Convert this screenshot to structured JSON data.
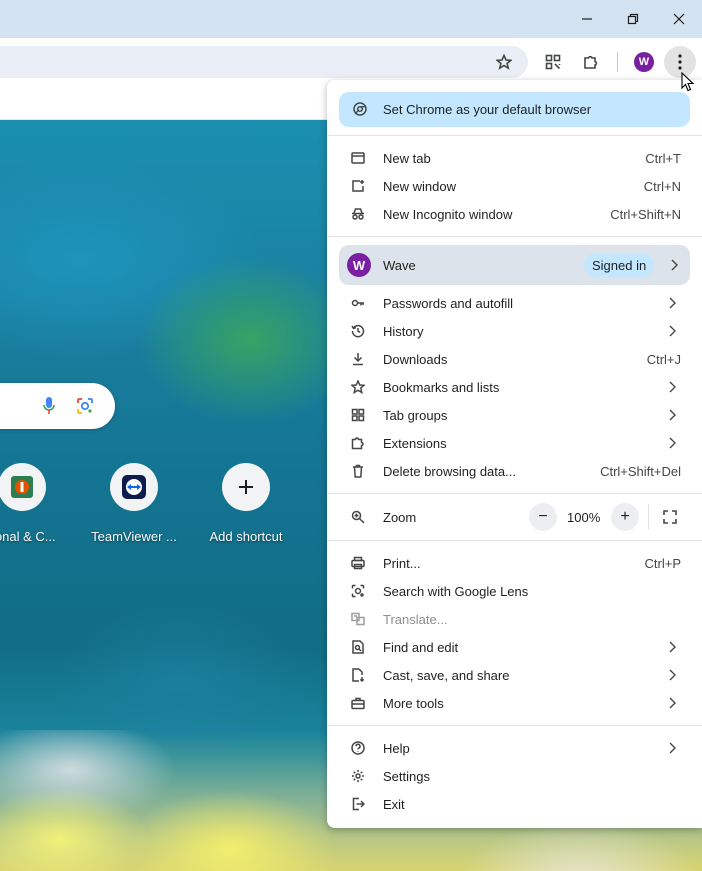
{
  "window_controls": {
    "minimize": "minimize",
    "restore": "restore",
    "close": "close"
  },
  "toolbar": {
    "profile_initial": "W"
  },
  "ntp": {
    "shortcuts": [
      {
        "label": "sonal & C..."
      },
      {
        "label": "TeamViewer ..."
      },
      {
        "label": "Add shortcut"
      }
    ]
  },
  "menu": {
    "banner": "Set Chrome as your default browser",
    "group1": [
      {
        "label": "New tab",
        "shortcut": "Ctrl+T"
      },
      {
        "label": "New window",
        "shortcut": "Ctrl+N"
      },
      {
        "label": "New Incognito window",
        "shortcut": "Ctrl+Shift+N"
      }
    ],
    "profile": {
      "initial": "W",
      "name": "Wave",
      "status": "Signed in"
    },
    "group2": [
      {
        "label": "Passwords and autofill"
      },
      {
        "label": "History"
      },
      {
        "label": "Downloads",
        "shortcut": "Ctrl+J"
      },
      {
        "label": "Bookmarks and lists"
      },
      {
        "label": "Tab groups"
      },
      {
        "label": "Extensions"
      },
      {
        "label": "Delete browsing data...",
        "shortcut": "Ctrl+Shift+Del"
      }
    ],
    "zoom": {
      "label": "Zoom",
      "minus": "−",
      "value": "100%",
      "plus": "+"
    },
    "group3": [
      {
        "label": "Print...",
        "shortcut": "Ctrl+P"
      },
      {
        "label": "Search with Google Lens"
      },
      {
        "label": "Translate..."
      },
      {
        "label": "Find and edit"
      },
      {
        "label": "Cast, save, and share"
      },
      {
        "label": "More tools"
      }
    ],
    "group4": [
      {
        "label": "Help"
      },
      {
        "label": "Settings"
      },
      {
        "label": "Exit"
      }
    ]
  }
}
